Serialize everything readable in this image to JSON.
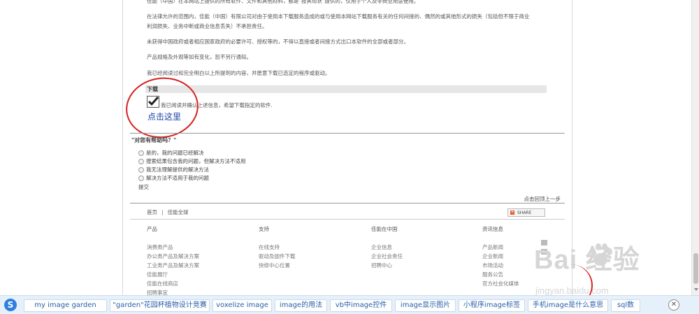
{
  "content": {
    "top_partial": "佳能（中国）在本网站上提供的所有软件、文件和其他材料，都是\"按其现状\"提供的，仅用于个人及非商业用途使用。",
    "para1_line1": "在法律允许的范围内，佳能（中国）有限公司对由于使用本下载服务造成的或与使用本网站下载服务有关的任何间接的、偶然的或其他形式的损失（包括但不限于商业",
    "para1_line2": "利润损失、业务中断或商业信息丢失）不承担责任。",
    "para2": "未获得中国政府或者相应国家政府的必要许可、授权等的，不得以直接或者间接方式出口本软件的全部或者部分。",
    "para3": "产品规格及外观等如有变化，恕不另行通知。",
    "para4": "我已经阅读过和完全明白以上所提到的内容，并愿意下载已选定的程序或驱动。"
  },
  "download": {
    "title": "下载",
    "checkbox_label": "我已阅读并确认上述信息，希望下载指定的软件.",
    "annotation": "点击这里"
  },
  "help": {
    "title": "\"对您有帮助吗？\"",
    "options": [
      "是的，我的问题已经解决",
      "搜索结果包含我的问题，但解决方法不适用",
      "我无法理解提供的解决方法",
      "解决方法不适用于我的问题"
    ],
    "submit": "提交"
  },
  "back_to_top": "点击回顶上一步",
  "footer": {
    "home": "首页",
    "separator": "|",
    "global": "佳能全球",
    "share": "SHARE",
    "columns": [
      {
        "head": "产品",
        "items": [
          "消费类产品",
          "办公类产品及解决方案",
          "工业类产品及解决方案",
          "佳能展厅",
          "佳能在线商店",
          "招聘事宜"
        ]
      },
      {
        "head": "支持",
        "items": [
          "在线支持",
          "驱动及固件下载",
          "快修中心位置"
        ]
      },
      {
        "head": "佳能在中国",
        "items": [
          "企业信息",
          "企业社会责任",
          "招聘中心"
        ]
      },
      {
        "head": "资讯信息",
        "items": [
          "产品新闻",
          "企业新闻",
          "市场活动",
          "服务公告",
          "官方社会化媒体"
        ]
      }
    ]
  },
  "watermark": {
    "main": "Bai  经验",
    "sub": "jingyan.baidu.com"
  },
  "bottom_bar": {
    "logo": "S",
    "chips": [
      "my image garden",
      "\"garden\"花园杯植物设计竞赛",
      "voxelize image",
      "image的用法",
      "vb中image控件",
      "image显示图片",
      "小程序image标签",
      "手机image是什么意思",
      "sql数"
    ],
    "close": "✕"
  },
  "colors": {
    "annotation_red": "#d62020",
    "link_blue": "#1a3ea6",
    "bar_bg": "#e6f0fa"
  }
}
